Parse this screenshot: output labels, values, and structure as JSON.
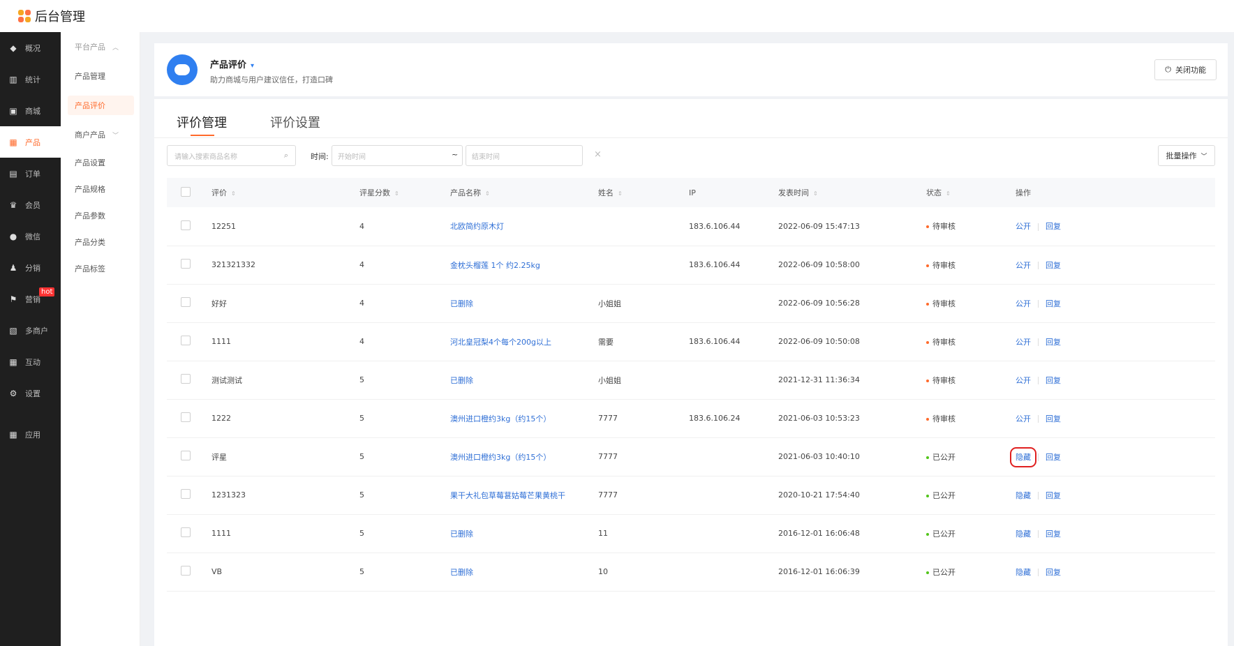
{
  "topbar": {
    "title": "后台管理"
  },
  "sidebar": {
    "items": [
      {
        "label": "概况",
        "icon": "graduation-cap-icon",
        "glyph": "◆"
      },
      {
        "label": "统计",
        "icon": "chart-icon",
        "glyph": "▥"
      },
      {
        "label": "商城",
        "icon": "store-icon",
        "glyph": "▣"
      },
      {
        "label": "产品",
        "icon": "product-icon",
        "glyph": "▦",
        "active": true
      },
      {
        "label": "订单",
        "icon": "order-icon",
        "glyph": "▤"
      },
      {
        "label": "会员",
        "icon": "crown-icon",
        "glyph": "♛"
      },
      {
        "label": "微信",
        "icon": "wechat-icon",
        "glyph": "●"
      },
      {
        "label": "分销",
        "icon": "distribution-icon",
        "glyph": "♟"
      },
      {
        "label": "营销",
        "icon": "flag-icon",
        "glyph": "⚑",
        "badge": "hot"
      },
      {
        "label": "多商户",
        "icon": "merchant-icon",
        "glyph": "▧"
      },
      {
        "label": "互动",
        "icon": "interact-icon",
        "glyph": "▦"
      },
      {
        "label": "设置",
        "icon": "gear-icon",
        "glyph": "⚙"
      },
      {
        "label": "应用",
        "icon": "apps-icon",
        "glyph": "▦"
      }
    ]
  },
  "subnav": {
    "group1": "平台产品",
    "group1_items": [
      "产品管理",
      "产品评价"
    ],
    "group2": "商户产品",
    "group2_items": [
      "产品设置",
      "产品规格",
      "产品参数",
      "产品分类",
      "产品标签"
    ]
  },
  "header": {
    "title": "产品评价",
    "subtitle": "助力商城与用户建议信任，打造口碑",
    "close_label": "关闭功能"
  },
  "tabs": [
    "评价管理",
    "评价设置"
  ],
  "filters": {
    "search_placeholder": "请输入搜索商品名称",
    "time_label": "时间:",
    "start_placeholder": "开始时间",
    "tilde": "~",
    "end_placeholder": "结束时间",
    "batch_label": "批量操作"
  },
  "table": {
    "columns": [
      "评价",
      "评星分数",
      "产品名称",
      "姓名",
      "IP",
      "发表时间",
      "状态",
      "操作"
    ],
    "rows": [
      {
        "review": "12251",
        "score": "4",
        "product": "北欧简约原木灯",
        "name": "",
        "ip": "183.6.106.44",
        "time": "2022-06-09 15:47:13",
        "status": "待审核",
        "op1": "公开",
        "op2": "回复"
      },
      {
        "review": "321321332",
        "score": "4",
        "product": "金枕头榴莲 1个 约2.25kg",
        "name": "",
        "ip": "183.6.106.44",
        "time": "2022-06-09 10:58:00",
        "status": "待审核",
        "op1": "公开",
        "op2": "回复"
      },
      {
        "review": "好好",
        "score": "4",
        "product": "已删除",
        "name": "小姐姐",
        "ip": "",
        "time": "2022-06-09 10:56:28",
        "status": "待审核",
        "op1": "公开",
        "op2": "回复"
      },
      {
        "review": "1111",
        "score": "4",
        "product": "河北皇冠梨4个每个200g以上",
        "name": "需要",
        "ip": "183.6.106.44",
        "time": "2022-06-09 10:50:08",
        "status": "待审核",
        "op1": "公开",
        "op2": "回复"
      },
      {
        "review": "测试测试",
        "score": "5",
        "product": "已删除",
        "name": "小姐姐",
        "ip": "",
        "time": "2021-12-31 11:36:34",
        "status": "待审核",
        "op1": "公开",
        "op2": "回复"
      },
      {
        "review": "1222",
        "score": "5",
        "product": "澳州进口橙约3kg（约15个）",
        "name": "7777",
        "ip": "183.6.106.24",
        "time": "2021-06-03 10:53:23",
        "status": "待审核",
        "op1": "公开",
        "op2": "回复"
      },
      {
        "review": "评星",
        "score": "5",
        "product": "澳州进口橙约3kg（约15个）",
        "name": "7777",
        "ip": "",
        "time": "2021-06-03 10:40:10",
        "status": "已公开",
        "op1": "隐藏",
        "op2": "回复",
        "highlight": true
      },
      {
        "review": "1231323",
        "score": "5",
        "product": "果干大礼包草莓葚姑莓芒果黄桃干",
        "name": "7777",
        "ip": "",
        "time": "2020-10-21 17:54:40",
        "status": "已公开",
        "op1": "隐藏",
        "op2": "回复"
      },
      {
        "review": "1111",
        "score": "5",
        "product": "已删除",
        "name": "11",
        "ip": "",
        "time": "2016-12-01 16:06:48",
        "status": "已公开",
        "op1": "隐藏",
        "op2": "回复"
      },
      {
        "review": "VB",
        "score": "5",
        "product": "已删除",
        "name": "10",
        "ip": "",
        "time": "2016-12-01 16:06:39",
        "status": "已公开",
        "op1": "隐藏",
        "op2": "回复"
      }
    ]
  },
  "colors": {
    "accent": "#ff6a2b",
    "link": "#2f6fd6",
    "pending": "#ff6a2b",
    "public": "#52c41a",
    "highlight": "#e02020"
  }
}
